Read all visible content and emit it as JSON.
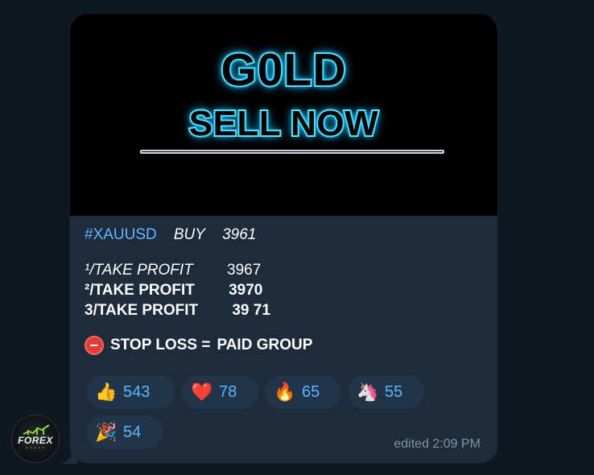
{
  "media": {
    "line1": "G0LD",
    "line2": "SELL NOW"
  },
  "message": {
    "hashtag": "#XAUUSD",
    "action": "BUY",
    "price": "3961",
    "tp1_label": "¹/TAKE PROFIT",
    "tp1_value": "3967",
    "tp2_label": "²/TAKE PROFIT",
    "tp2_value": "3970",
    "tp3_label": "3/TAKE PROFIT",
    "tp3_value": "39 71",
    "stop_loss_label": "STOP LOSS =",
    "stop_loss_value": "PAID GROUP"
  },
  "reactions": [
    {
      "emoji": "👍",
      "icon": "thumbs-up-icon",
      "count": "543"
    },
    {
      "emoji": "❤️",
      "icon": "heart-icon",
      "count": "78"
    },
    {
      "emoji": "🔥",
      "icon": "fire-icon",
      "count": "65"
    },
    {
      "emoji": "🦄",
      "icon": "unicorn-icon",
      "count": "55"
    },
    {
      "emoji": "🎉",
      "icon": "party-popper-icon",
      "count": "54"
    }
  ],
  "meta": {
    "edited_time": "edited 2:09 PM"
  },
  "avatar": {
    "brand": "FOREX"
  },
  "colors": {
    "background": "#0f1720",
    "bubble": "#1d2b3a",
    "hashtag": "#64b5ff",
    "reaction_bg": "#223447",
    "reaction_text": "#5ab4ff",
    "neon": "#59e6ff",
    "meta": "#7f93a6"
  }
}
